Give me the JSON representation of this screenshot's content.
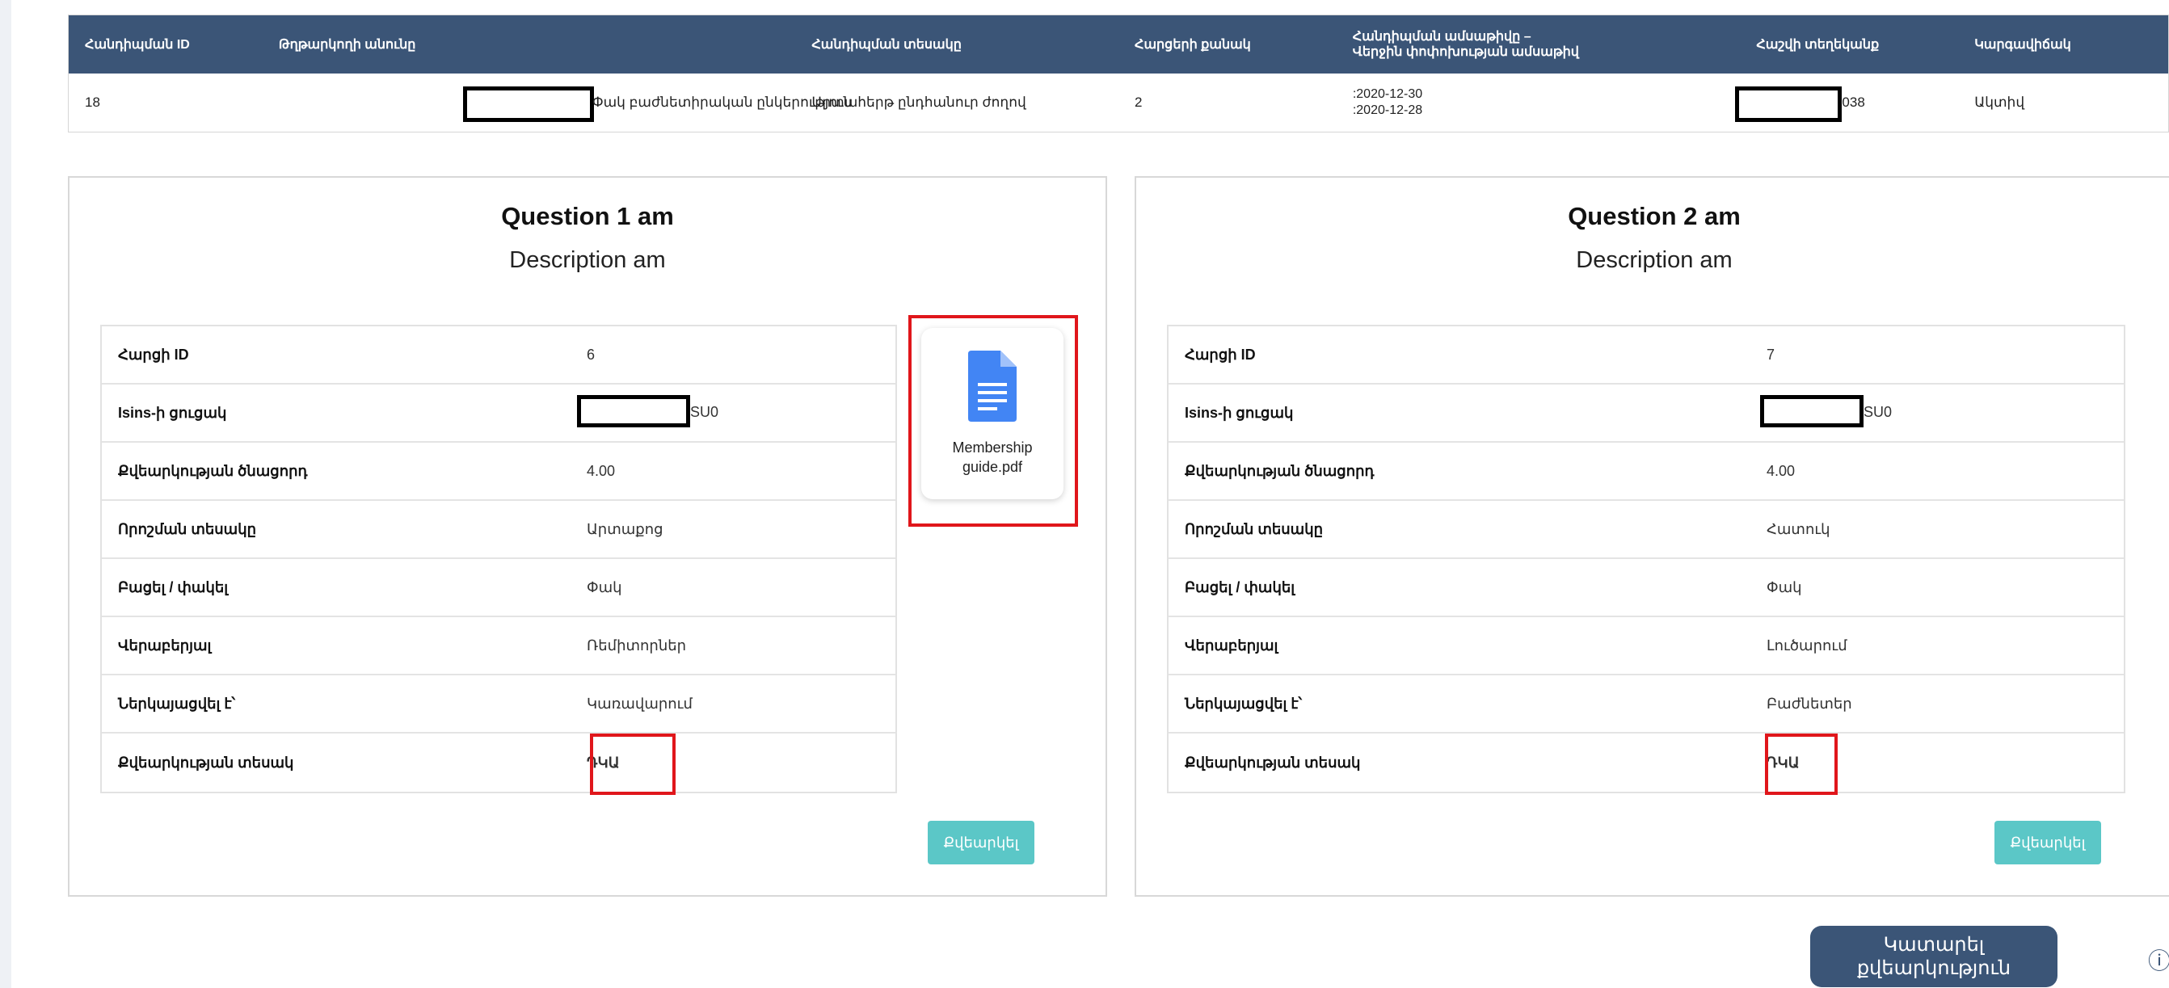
{
  "table": {
    "headers": [
      "Հանդիպման ID",
      "Թղթարկողի անունը",
      "Հանդիպման տեսակը",
      "Հարցերի քանակ",
      "Հանդիպման ամսաթիվը –\nՎերջին փոփոխության ամսաթիվ",
      "Հաշվի տեղեկանք",
      "Կարգավիճակ"
    ],
    "row": {
      "id": "18",
      "name_suffix": "Փակ բաժնետիրական ընկերություն",
      "type": "Արտահերթ ընդհանուր ժողով",
      "questions_count": "2",
      "meeting_date": ":2020-12-30",
      "last_modified": ":2020-12-28",
      "account_suffix": "038",
      "status": "Ակտիվ"
    }
  },
  "questions": [
    {
      "title": "Question 1 am",
      "description": "Description am",
      "rows": [
        {
          "label": "Հարցի ID",
          "value": "6"
        },
        {
          "label": "Isins-ի ցուցակ",
          "value": "SU0"
        },
        {
          "label": "Քվեարկության ծնացորդ",
          "value": "4.00"
        },
        {
          "label": "Որոշման տեսակը",
          "value": "Արտաքոց"
        },
        {
          "label": "Բացել / փակել",
          "value": "Փակ"
        },
        {
          "label": "Վերաբերյալ",
          "value": "Ռեմիտորներ"
        },
        {
          "label": "Ներկայացվել է՝",
          "value": "Կառավարում"
        },
        {
          "label": "Քվեարկության տեսակ",
          "value": "ԴԿԱ"
        }
      ],
      "attachment": {
        "name": "Membership guide.pdf",
        "icon": "document-icon"
      },
      "vote_label": "Քվեարկել"
    },
    {
      "title": "Question 2 am",
      "description": "Description am",
      "rows": [
        {
          "label": "Հարցի ID",
          "value": "7"
        },
        {
          "label": "Isins-ի ցուցակ",
          "value": "SU0"
        },
        {
          "label": "Քվեարկության ծնացորդ",
          "value": "4.00"
        },
        {
          "label": "Որոշման տեսակը",
          "value": "Հատուկ"
        },
        {
          "label": "Բացել / փակել",
          "value": "Փակ"
        },
        {
          "label": "Վերաբերյալ",
          "value": "Լուծարում"
        },
        {
          "label": "Ներկայացվել է՝",
          "value": "Բաժնետեր"
        },
        {
          "label": "Քվեարկության տեսակ",
          "value": "ԴԿԱ"
        }
      ],
      "vote_label": "Քվեարկել"
    }
  ],
  "submit_label": "Կատարել քվեարկություն",
  "info_icon": "ⓘ",
  "colors": {
    "header": "#3b5577",
    "button": "#5bc7c7",
    "highlight": "#e0161b"
  }
}
